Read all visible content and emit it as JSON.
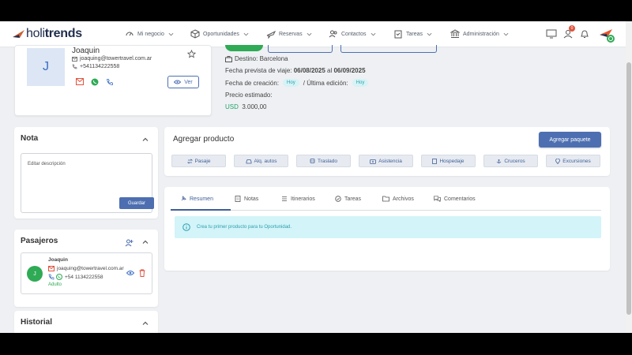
{
  "brand": {
    "prefix": "holi",
    "suffix": "trends"
  },
  "nav": [
    {
      "label": "Mi negocio",
      "icon": "gauge-icon"
    },
    {
      "label": "Oportunidades",
      "icon": "cube-icon"
    },
    {
      "label": "Reservas",
      "icon": "plane-icon"
    },
    {
      "label": "Contactos",
      "icon": "contacts-icon"
    },
    {
      "label": "Tareas",
      "icon": "clipboard-icon"
    },
    {
      "label": "Administración",
      "icon": "bank-icon"
    }
  ],
  "notifications_count": "0",
  "client": {
    "initial": "J",
    "name": "Joaquin",
    "email": "joaquing@towertravel.com.ar",
    "phone": "+541134222558",
    "ver_label": "Ver"
  },
  "trip": {
    "destino_label": "Destino:",
    "destino": "Barcelona",
    "fecha_label": "Fecha prevista de viaje:",
    "fecha_desde": "06/08/2025",
    "al": "al",
    "fecha_hasta": "06/09/2025",
    "creacion_label": "Fecha de creación:",
    "creacion_chip": "Hoy",
    "separator": "/",
    "edicion_label": "Última edición:",
    "edicion_chip": "Hoy",
    "precio_label": "Precio estimado:",
    "moneda": "USD",
    "precio": "3.000,00"
  },
  "nota": {
    "title": "Nota",
    "placeholder": "Editar descripción",
    "save_label": "Guardar"
  },
  "pasajeros": {
    "title": "Pasajeros",
    "items": [
      {
        "initial": "J",
        "name": "Joaquin",
        "email": "joaquing@towertravel.com.ar",
        "phone": "+54 1134222558",
        "type": "Adulto"
      }
    ]
  },
  "historial": {
    "title": "Historial"
  },
  "agregar": {
    "title": "Agregar producto",
    "paquete_label": "Agregar paquete",
    "products": [
      {
        "label": "Pasaje",
        "icon": "swap-icon"
      },
      {
        "label": "Alq. autos",
        "icon": "car-icon"
      },
      {
        "label": "Traslado",
        "icon": "bus-icon"
      },
      {
        "label": "Asistencia",
        "icon": "medkit-icon"
      },
      {
        "label": "Hospedaje",
        "icon": "building-icon"
      },
      {
        "label": "Cruceros",
        "icon": "anchor-icon"
      },
      {
        "label": "Excursiones",
        "icon": "pin-icon"
      }
    ]
  },
  "tabs": [
    {
      "label": "Resumen",
      "icon": "pin-outline-icon",
      "active": true
    },
    {
      "label": "Notas",
      "icon": "note-icon"
    },
    {
      "label": "Itinerarios",
      "icon": "list-icon"
    },
    {
      "label": "Tareas",
      "icon": "check-circle-icon"
    },
    {
      "label": "Archivos",
      "icon": "folder-icon"
    },
    {
      "label": "Comentarios",
      "icon": "comments-icon"
    }
  ],
  "banner": {
    "text": "Crea tu primer producto para tu Oportunidad."
  },
  "colors": {
    "primary": "#4d6fb1",
    "success": "#2faa55",
    "info_bg": "#d3f4f8",
    "info_text": "#2a9fb0"
  }
}
